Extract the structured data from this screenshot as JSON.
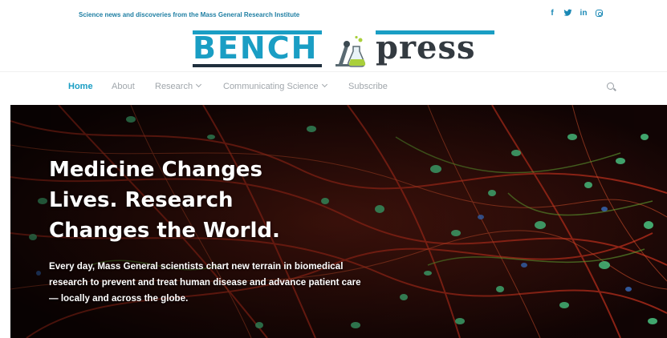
{
  "header": {
    "tagline": "Science news and discoveries from the Mass General Research Institute",
    "social_icons": [
      "facebook-icon",
      "twitter-icon",
      "linkedin-icon",
      "instagram-icon"
    ],
    "social_glyphs": {
      "facebook": "f",
      "twitter": "t",
      "linkedin": "in"
    },
    "logo": {
      "word1": "BENCH",
      "word2": "press",
      "brand_blue": "#1a9ec4",
      "brand_dark": "#333a40"
    }
  },
  "nav": {
    "items": [
      {
        "label": "Home",
        "active": true
      },
      {
        "label": "About"
      },
      {
        "label": "Research",
        "dropdown": true
      },
      {
        "label": "Communicating Science",
        "dropdown": true
      },
      {
        "label": "Subscribe"
      }
    ],
    "accent": "#1a9ec4"
  },
  "hero": {
    "title": "Medicine Changes Lives. Research Changes the World.",
    "description": "Every day, Mass General scientists chart new terrain in biomedical research to prevent and treat human disease and advance patient care — locally and across the globe."
  }
}
